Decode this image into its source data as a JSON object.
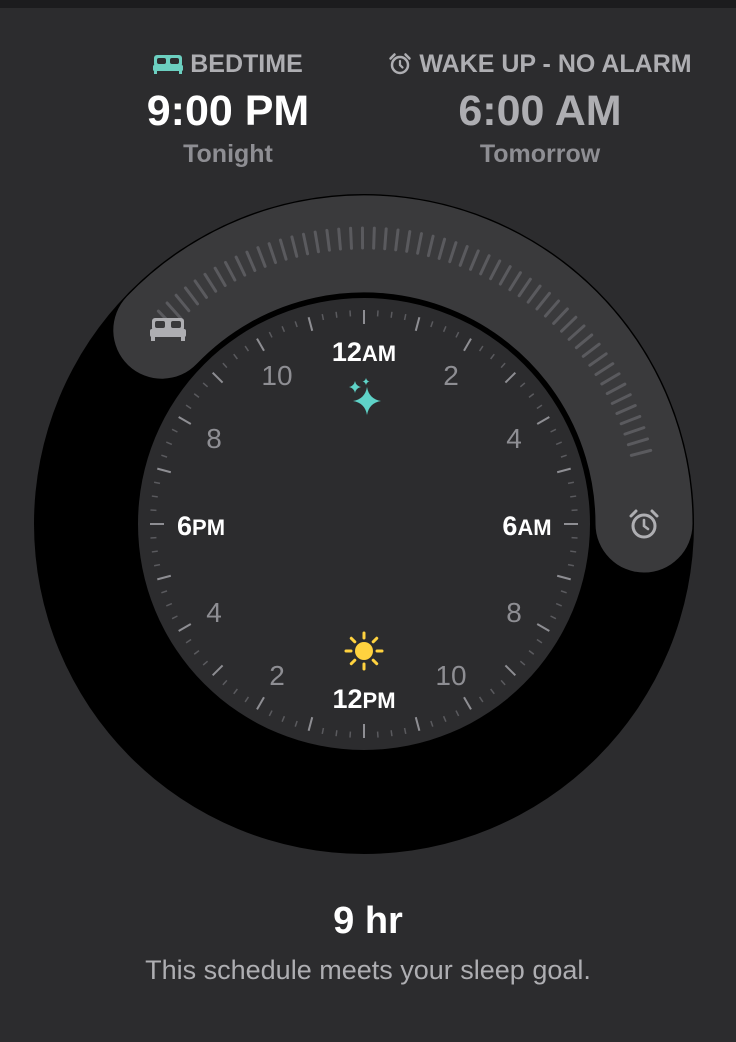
{
  "bedtime": {
    "label": "BEDTIME",
    "time": "9:00 PM",
    "day": "Tonight",
    "icon": "bed-icon",
    "icon_color": "#6ccfc0"
  },
  "wake": {
    "label": "WAKE UP - NO ALARM",
    "time": "6:00 AM",
    "day": "Tomorrow",
    "icon": "alarm-clock-icon"
  },
  "dial": {
    "hours": {
      "top": "12",
      "top_suffix": "AM",
      "right": "6",
      "right_suffix": "AM",
      "bottom": "12",
      "bottom_suffix": "PM",
      "left": "6",
      "left_suffix": "PM",
      "h2": "2",
      "h4": "4",
      "h8": "8",
      "h10": "10",
      "h14": "2",
      "h16": "4",
      "h20": "8",
      "h22": "10"
    },
    "night_icon": "sparkles-icon",
    "night_icon_color": "#5fd3c8",
    "day_icon": "sun-icon",
    "day_icon_color": "#ffd23f"
  },
  "summary": {
    "duration": "9 hr",
    "message": "This schedule meets your sleep goal."
  }
}
